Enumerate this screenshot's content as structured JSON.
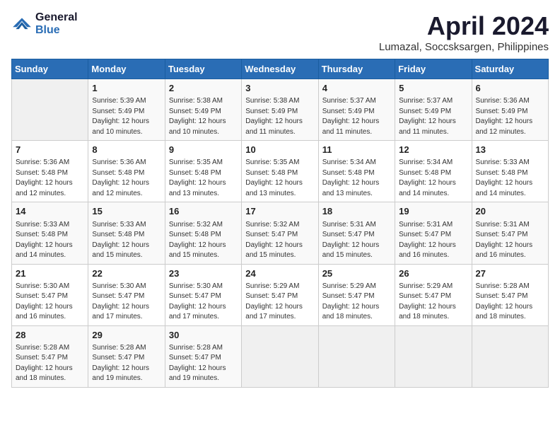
{
  "logo": {
    "general": "General",
    "blue": "Blue"
  },
  "header": {
    "title": "April 2024",
    "subtitle": "Lumazal, Soccsksargen, Philippines"
  },
  "weekdays": [
    "Sunday",
    "Monday",
    "Tuesday",
    "Wednesday",
    "Thursday",
    "Friday",
    "Saturday"
  ],
  "weeks": [
    [
      {
        "day": "",
        "info": ""
      },
      {
        "day": "1",
        "info": "Sunrise: 5:39 AM\nSunset: 5:49 PM\nDaylight: 12 hours\nand 10 minutes."
      },
      {
        "day": "2",
        "info": "Sunrise: 5:38 AM\nSunset: 5:49 PM\nDaylight: 12 hours\nand 10 minutes."
      },
      {
        "day": "3",
        "info": "Sunrise: 5:38 AM\nSunset: 5:49 PM\nDaylight: 12 hours\nand 11 minutes."
      },
      {
        "day": "4",
        "info": "Sunrise: 5:37 AM\nSunset: 5:49 PM\nDaylight: 12 hours\nand 11 minutes."
      },
      {
        "day": "5",
        "info": "Sunrise: 5:37 AM\nSunset: 5:49 PM\nDaylight: 12 hours\nand 11 minutes."
      },
      {
        "day": "6",
        "info": "Sunrise: 5:36 AM\nSunset: 5:49 PM\nDaylight: 12 hours\nand 12 minutes."
      }
    ],
    [
      {
        "day": "7",
        "info": "Sunrise: 5:36 AM\nSunset: 5:48 PM\nDaylight: 12 hours\nand 12 minutes."
      },
      {
        "day": "8",
        "info": "Sunrise: 5:36 AM\nSunset: 5:48 PM\nDaylight: 12 hours\nand 12 minutes."
      },
      {
        "day": "9",
        "info": "Sunrise: 5:35 AM\nSunset: 5:48 PM\nDaylight: 12 hours\nand 13 minutes."
      },
      {
        "day": "10",
        "info": "Sunrise: 5:35 AM\nSunset: 5:48 PM\nDaylight: 12 hours\nand 13 minutes."
      },
      {
        "day": "11",
        "info": "Sunrise: 5:34 AM\nSunset: 5:48 PM\nDaylight: 12 hours\nand 13 minutes."
      },
      {
        "day": "12",
        "info": "Sunrise: 5:34 AM\nSunset: 5:48 PM\nDaylight: 12 hours\nand 14 minutes."
      },
      {
        "day": "13",
        "info": "Sunrise: 5:33 AM\nSunset: 5:48 PM\nDaylight: 12 hours\nand 14 minutes."
      }
    ],
    [
      {
        "day": "14",
        "info": "Sunrise: 5:33 AM\nSunset: 5:48 PM\nDaylight: 12 hours\nand 14 minutes."
      },
      {
        "day": "15",
        "info": "Sunrise: 5:33 AM\nSunset: 5:48 PM\nDaylight: 12 hours\nand 15 minutes."
      },
      {
        "day": "16",
        "info": "Sunrise: 5:32 AM\nSunset: 5:48 PM\nDaylight: 12 hours\nand 15 minutes."
      },
      {
        "day": "17",
        "info": "Sunrise: 5:32 AM\nSunset: 5:47 PM\nDaylight: 12 hours\nand 15 minutes."
      },
      {
        "day": "18",
        "info": "Sunrise: 5:31 AM\nSunset: 5:47 PM\nDaylight: 12 hours\nand 15 minutes."
      },
      {
        "day": "19",
        "info": "Sunrise: 5:31 AM\nSunset: 5:47 PM\nDaylight: 12 hours\nand 16 minutes."
      },
      {
        "day": "20",
        "info": "Sunrise: 5:31 AM\nSunset: 5:47 PM\nDaylight: 12 hours\nand 16 minutes."
      }
    ],
    [
      {
        "day": "21",
        "info": "Sunrise: 5:30 AM\nSunset: 5:47 PM\nDaylight: 12 hours\nand 16 minutes."
      },
      {
        "day": "22",
        "info": "Sunrise: 5:30 AM\nSunset: 5:47 PM\nDaylight: 12 hours\nand 17 minutes."
      },
      {
        "day": "23",
        "info": "Sunrise: 5:30 AM\nSunset: 5:47 PM\nDaylight: 12 hours\nand 17 minutes."
      },
      {
        "day": "24",
        "info": "Sunrise: 5:29 AM\nSunset: 5:47 PM\nDaylight: 12 hours\nand 17 minutes."
      },
      {
        "day": "25",
        "info": "Sunrise: 5:29 AM\nSunset: 5:47 PM\nDaylight: 12 hours\nand 18 minutes."
      },
      {
        "day": "26",
        "info": "Sunrise: 5:29 AM\nSunset: 5:47 PM\nDaylight: 12 hours\nand 18 minutes."
      },
      {
        "day": "27",
        "info": "Sunrise: 5:28 AM\nSunset: 5:47 PM\nDaylight: 12 hours\nand 18 minutes."
      }
    ],
    [
      {
        "day": "28",
        "info": "Sunrise: 5:28 AM\nSunset: 5:47 PM\nDaylight: 12 hours\nand 18 minutes."
      },
      {
        "day": "29",
        "info": "Sunrise: 5:28 AM\nSunset: 5:47 PM\nDaylight: 12 hours\nand 19 minutes."
      },
      {
        "day": "30",
        "info": "Sunrise: 5:28 AM\nSunset: 5:47 PM\nDaylight: 12 hours\nand 19 minutes."
      },
      {
        "day": "",
        "info": ""
      },
      {
        "day": "",
        "info": ""
      },
      {
        "day": "",
        "info": ""
      },
      {
        "day": "",
        "info": ""
      }
    ]
  ]
}
